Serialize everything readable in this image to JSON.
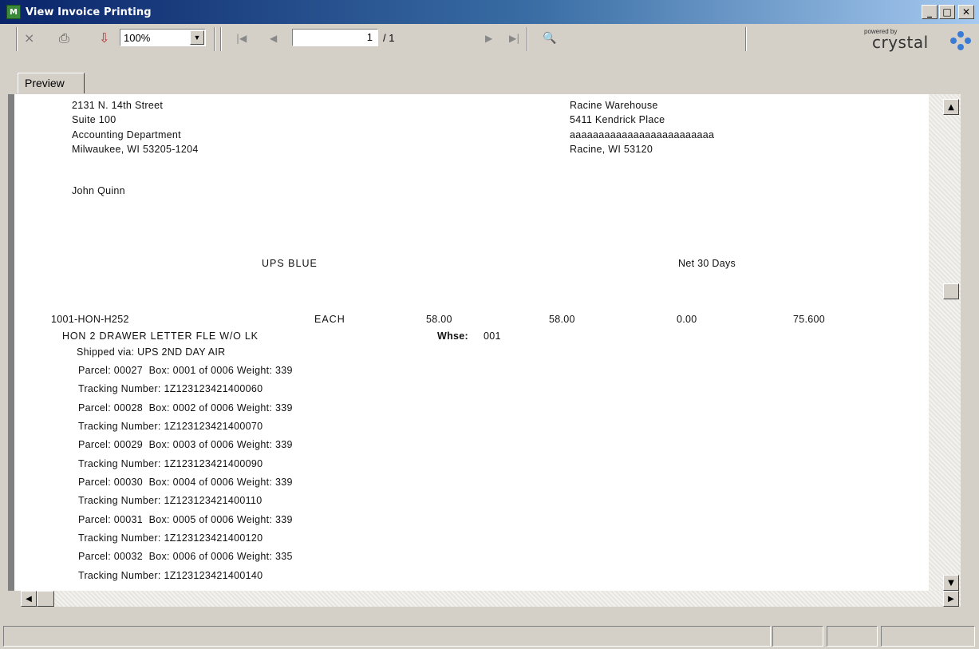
{
  "window": {
    "title": "View Invoice Printing",
    "app_icon": "M"
  },
  "toolbar": {
    "close_icon": "×",
    "print_icon": "⎙",
    "export_icon": "⇩",
    "zoom_value": "100%",
    "first_icon": "|◀",
    "prev_icon": "◀",
    "page_value": "1",
    "page_total": "/ 1",
    "next_icon": "▶",
    "last_icon": "▶|",
    "search_icon": "🔍",
    "powered_by": "powered by",
    "brand": "crystal"
  },
  "tabs": [
    {
      "label": "Preview"
    }
  ],
  "document": {
    "bill_to": {
      "line1": "2131 N. 14th Street",
      "line2": "Suite 100",
      "line3": "Accounting Department",
      "line4": "Milwaukee, WI 53205-1204",
      "contact": "John Quinn"
    },
    "ship_to": {
      "line1": "Racine Warehouse",
      "line2": "5411 Kendrick Place",
      "line3": "aaaaaaaaaaaaaaaaaaaaaaaaa",
      "line4": "Racine, WI 53120"
    },
    "ship_via": "UPS BLUE",
    "terms": "Net 30 Days",
    "line_item": {
      "item_code": "1001-HON-H252",
      "unit": "EACH",
      "ordered": "58.00",
      "shipped": "58.00",
      "backordered": "0.00",
      "price": "75.600",
      "description": "HON 2 DRAWER LETTER FLE W/O LK",
      "whse_label": "Whse:",
      "whse_value": "001",
      "shipped_via": "Shipped via: UPS 2ND DAY AIR"
    },
    "parcels": [
      {
        "parcel": "Parcel: 00027  Box: 0001 of 0006 Weight: 339",
        "tracking": "Tracking Number: 1Z123123421400060"
      },
      {
        "parcel": "Parcel: 00028  Box: 0002 of 0006 Weight: 339",
        "tracking": "Tracking Number: 1Z123123421400070"
      },
      {
        "parcel": "Parcel: 00029  Box: 0003 of 0006 Weight: 339",
        "tracking": "Tracking Number: 1Z123123421400090"
      },
      {
        "parcel": "Parcel: 00030  Box: 0004 of 0006 Weight: 339",
        "tracking": "Tracking Number: 1Z123123421400110"
      },
      {
        "parcel": "Parcel: 00031  Box: 0005 of 0006 Weight: 339",
        "tracking": "Tracking Number: 1Z123123421400120"
      },
      {
        "parcel": "Parcel: 00032  Box: 0006 of 0006 Weight: 335",
        "tracking": "Tracking Number: 1Z123123421400140"
      }
    ]
  },
  "scrollbars": {
    "up_icon": "▲",
    "down_icon": "▼",
    "left_icon": "◀",
    "right_icon": "▶",
    "vertical_position": 0.38
  },
  "colors": {
    "title_start": "#0a246a",
    "title_end": "#a6caf0",
    "chrome": "#d4d0c8",
    "crystal_blue": "#3a7bd5"
  }
}
